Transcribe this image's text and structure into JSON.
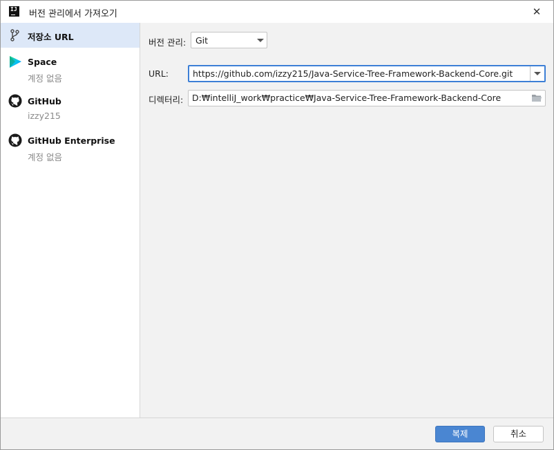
{
  "window": {
    "title": "버전 관리에서 가져오기",
    "app_icon": "intellij-icon",
    "close_glyph": "✕"
  },
  "sidebar": {
    "items": [
      {
        "title": "저장소 URL",
        "subtitle": "",
        "icon": "git-branch-icon",
        "selected": true
      },
      {
        "title": "Space",
        "subtitle": "계정 없음",
        "icon": "space-icon"
      },
      {
        "title": "GitHub",
        "subtitle": "izzy215",
        "icon": "github-icon"
      },
      {
        "title": "GitHub Enterprise",
        "subtitle": "계정 없음",
        "icon": "github-icon"
      }
    ]
  },
  "form": {
    "vcs_label": "버전 관리:",
    "vcs_value": "Git",
    "url_label": "URL:",
    "url_value": "https://github.com/izzy215/Java-Service-Tree-Framework-Backend-Core.git",
    "dir_label": "디렉터리:",
    "dir_value": "D:₩intelliJ_work₩practice₩Java-Service-Tree-Framework-Backend-Core"
  },
  "footer": {
    "clone_label": "복제",
    "cancel_label": "취소"
  },
  "colors": {
    "accent": "#3c7fd6",
    "primary_button": "#4a86d2",
    "selected_row": "#dde8f8"
  }
}
